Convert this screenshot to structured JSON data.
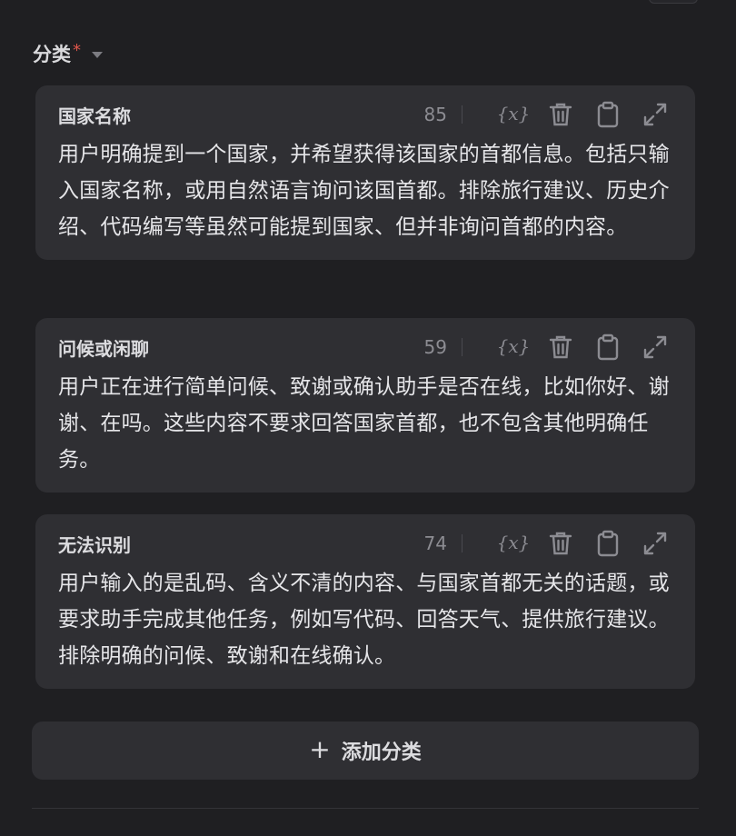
{
  "section": {
    "title": "分类",
    "required_mark": "*"
  },
  "categories": [
    {
      "name": "国家名称",
      "count": "85",
      "description": "用户明确提到一个国家，并希望获得该国家的首都信息。包括只输入国家名称，或用自然语言询问该国首都。排除旅行建议、历史介绍、代码编写等虽然可能提到国家、但并非询问首都的内容。"
    },
    {
      "name": "问候或闲聊",
      "count": "59",
      "description": "用户正在进行简单问候、致谢或确认助手是否在线，比如你好、谢谢、在吗。这些内容不要求回答国家首都，也不包含其他明确任务。"
    },
    {
      "name": "无法识别",
      "count": "74",
      "description": "用户输入的是乱码、含义不清的内容、与国家首都无关的话题，或要求助手完成其他任务，例如写代码、回答天气、提供旅行建议。排除明确的问候、致谢和在线确认。"
    }
  ],
  "add_button": {
    "icon": "+",
    "label": "添加分类"
  },
  "icons": [
    "variable-icon",
    "trash-icon",
    "clipboard-icon",
    "expand-icon",
    "chevron-down-icon"
  ],
  "colors": {
    "background": "#1f1f22",
    "card": "#2f2f33",
    "required": "#e0564b"
  }
}
